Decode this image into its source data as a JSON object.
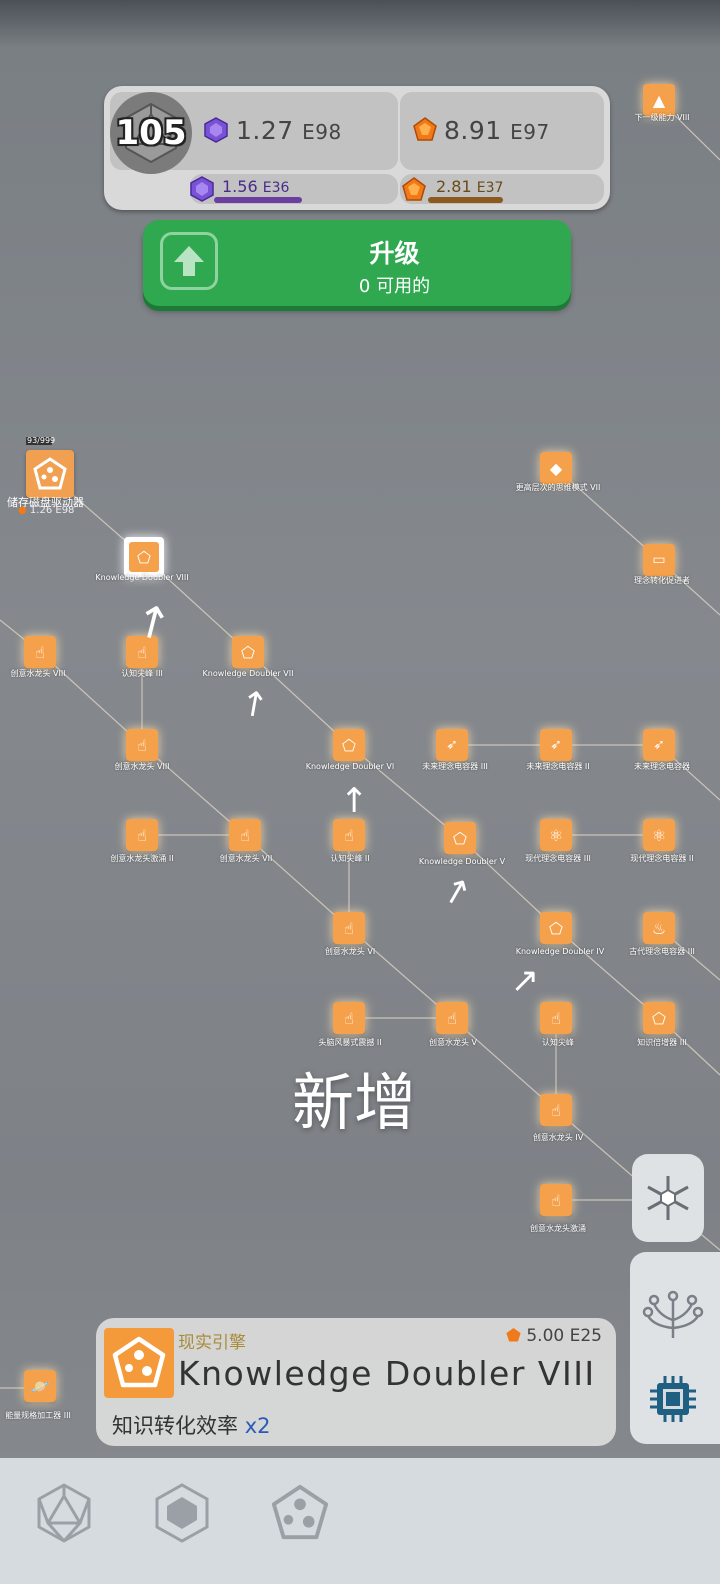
{
  "header": {
    "level": "105",
    "purple_total": {
      "mantissa": "1.27",
      "exp": "E98"
    },
    "orange_total": {
      "mantissa": "8.91",
      "exp": "E97"
    },
    "purple_rate": {
      "mantissa": "1.56",
      "exp": "E36",
      "progress": 0.44
    },
    "orange_rate": {
      "mantissa": "2.81",
      "exp": "E37",
      "progress": 0.47
    }
  },
  "upgrade": {
    "title": "升级",
    "subtitle": "0 可用的"
  },
  "storage": {
    "count": "93/999",
    "label": "储存磁盘驱动器",
    "value": "1.26",
    "exp": "E98"
  },
  "nodes": [
    {
      "label": "下一级能力 VIII"
    },
    {
      "label": "更高层次的思维模式 VII"
    },
    {
      "label": "理念转化促进者"
    },
    {
      "label": "Knowledge Doubler VIII"
    },
    {
      "label": "创意水龙头 VIII"
    },
    {
      "label": "认知尖峰 III"
    },
    {
      "label": "Knowledge Doubler VII"
    },
    {
      "label": "创意水龙头 VIII"
    },
    {
      "label": "Knowledge Doubler VI"
    },
    {
      "label": "未来理念电容器 III"
    },
    {
      "label": "未来理念电容器 II"
    },
    {
      "label": "未来理念电容器"
    },
    {
      "label": "创意水龙头激涌 II"
    },
    {
      "label": "创意水龙头 VII"
    },
    {
      "label": "认知尖峰 II"
    },
    {
      "label": "Knowledge Doubler V"
    },
    {
      "label": "现代理念电容器 III"
    },
    {
      "label": "现代理念电容器 II"
    },
    {
      "label": "创意水龙头 VI"
    },
    {
      "label": "Knowledge Doubler IV"
    },
    {
      "label": "古代理念电容器 III"
    },
    {
      "label": "头脑风暴式震撼 II"
    },
    {
      "label": "创意水龙头 V"
    },
    {
      "label": "认知尖峰"
    },
    {
      "label": "知识倍增器 III"
    },
    {
      "label": "创意水龙头 IV"
    },
    {
      "label": "创意水龙头激涌"
    },
    {
      "label": "能量规格加工器 III"
    }
  ],
  "new_label": "新增",
  "info_card": {
    "category": "现实引擎",
    "cost_mantissa": "5.00",
    "cost_exp": "E25",
    "name": "Knowledge Doubler VIII",
    "effect_label": "知识转化效率",
    "effect_mult": "x2"
  },
  "icons": {
    "level": "d20-icon",
    "purple_gem": "purple-gem-icon",
    "orange_gem": "orange-gem-icon",
    "upgrade": "arrow-up-icon",
    "tabs": [
      "d20-tab-icon",
      "hexagon-tab-icon",
      "cookie-tab-icon"
    ],
    "side": [
      "hexagon-network-icon",
      "tree-icon",
      "chip-icon"
    ]
  },
  "colors": {
    "upgrade_green": "#2fa84f",
    "node_orange": "#f5a04a",
    "purple_bar": "#6a3fa0",
    "orange_bar": "#8c5a1e"
  }
}
